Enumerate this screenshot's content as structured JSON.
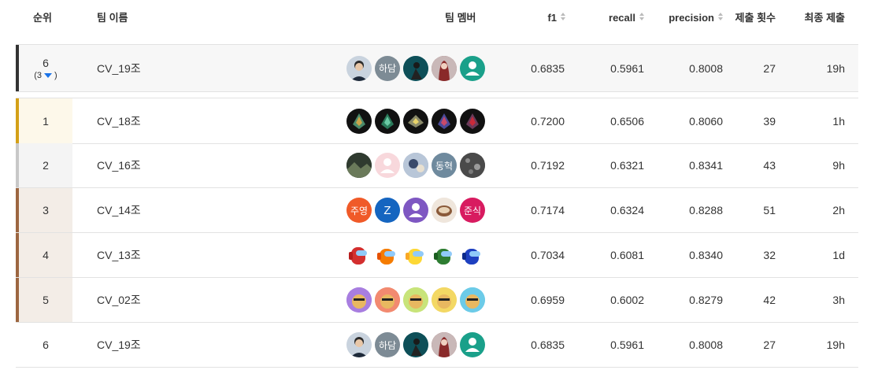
{
  "header": {
    "rank": "순위",
    "team": "팀 이름",
    "members": "팀 멤버",
    "f1": "f1",
    "recall": "recall",
    "precision": "precision",
    "submissions": "제출 횟수",
    "last": "최종 제출"
  },
  "my_team": {
    "rank": "6",
    "change_open": "(3",
    "change_close": ")",
    "team": "CV_19조",
    "f1": "0.6835",
    "recall": "0.5961",
    "precision": "0.8008",
    "submissions": "27",
    "last": "19h"
  },
  "rows": [
    {
      "rank": "1",
      "team": "CV_18조",
      "f1": "0.7200",
      "recall": "0.6506",
      "precision": "0.8060",
      "submissions": "39",
      "last": "1h"
    },
    {
      "rank": "2",
      "team": "CV_16조",
      "f1": "0.7192",
      "recall": "0.6321",
      "precision": "0.8341",
      "submissions": "43",
      "last": "9h"
    },
    {
      "rank": "3",
      "team": "CV_14조",
      "f1": "0.7174",
      "recall": "0.6324",
      "precision": "0.8288",
      "submissions": "51",
      "last": "2h"
    },
    {
      "rank": "4",
      "team": "CV_13조",
      "f1": "0.7034",
      "recall": "0.6081",
      "precision": "0.8340",
      "submissions": "32",
      "last": "1d"
    },
    {
      "rank": "5",
      "team": "CV_02조",
      "f1": "0.6959",
      "recall": "0.6002",
      "precision": "0.8279",
      "submissions": "42",
      "last": "3h"
    },
    {
      "rank": "6",
      "team": "CV_19조",
      "f1": "0.6835",
      "recall": "0.5961",
      "precision": "0.8008",
      "submissions": "27",
      "last": "19h"
    }
  ],
  "avatar_text": {
    "hadam": "하담",
    "donghyuk": "동혁",
    "juyoung": "주영",
    "z": "Z",
    "junsik": "준식"
  },
  "colors": {
    "gold": "#d4a017",
    "silver": "#c8c8c8",
    "bronze": "#9c6640",
    "my_team_bar": "#333333",
    "change_down": "#1a73e8"
  }
}
